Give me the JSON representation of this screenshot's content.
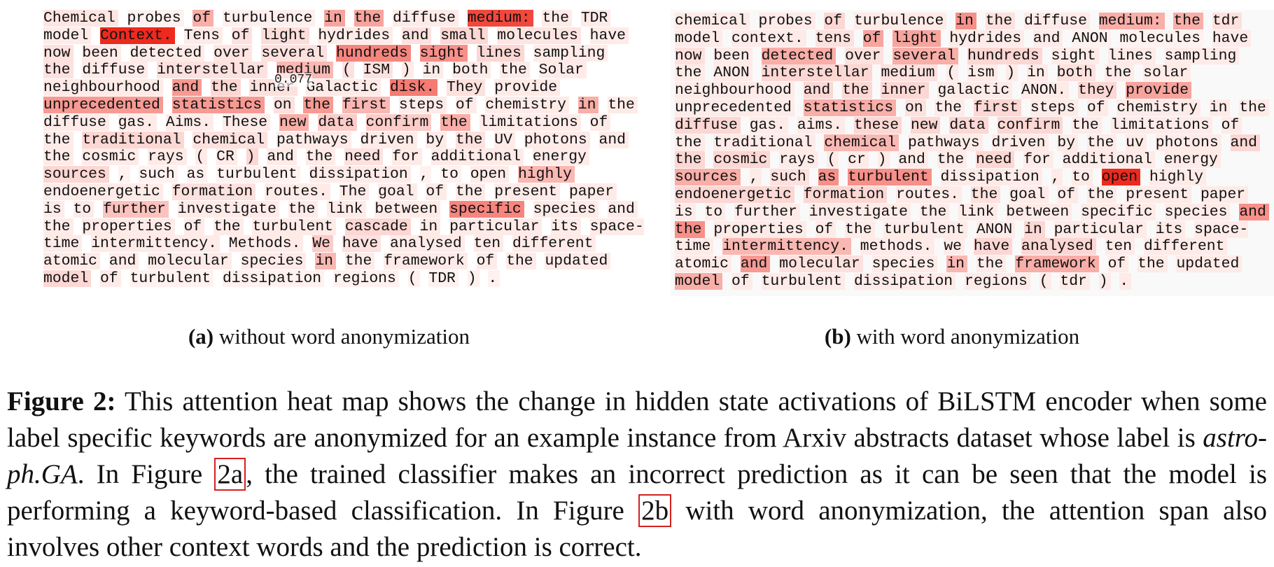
{
  "panel_a": {
    "tooltip_value": "0.077",
    "words": [
      {
        "t": "Chemical",
        "a": 0.08
      },
      {
        "t": "probes",
        "a": 0.02
      },
      {
        "t": "of",
        "a": 0.35
      },
      {
        "t": "turbulence",
        "a": 0.03
      },
      {
        "t": "in",
        "a": 0.4
      },
      {
        "t": "the",
        "a": 0.4
      },
      {
        "t": "diffuse",
        "a": 0.05
      },
      {
        "t": "medium:",
        "a": 0.85
      },
      {
        "t": "the",
        "a": 0.05
      },
      {
        "t": "TDR",
        "a": 0.05
      },
      {
        "t": "model",
        "a": 0.05
      },
      {
        "t": "Context.",
        "a": 1.0
      },
      {
        "t": "Tens",
        "a": 0.05
      },
      {
        "t": "of",
        "a": 0.1
      },
      {
        "t": "light",
        "a": 0.12
      },
      {
        "t": "hydrides",
        "a": 0.05
      },
      {
        "t": "and",
        "a": 0.1
      },
      {
        "t": "small",
        "a": 0.15
      },
      {
        "t": "molecules",
        "a": 0.08
      },
      {
        "t": "have",
        "a": 0.05
      },
      {
        "t": "now",
        "a": 0.1
      },
      {
        "t": "been",
        "a": 0.05
      },
      {
        "t": "detected",
        "a": 0.05
      },
      {
        "t": "over",
        "a": 0.08
      },
      {
        "t": "several",
        "a": 0.1
      },
      {
        "t": "hundreds",
        "a": 0.55
      },
      {
        "t": "sight",
        "a": 0.5
      },
      {
        "t": "lines",
        "a": 0.15
      },
      {
        "t": "sampling",
        "a": 0.05
      },
      {
        "t": "the",
        "a": 0.1
      },
      {
        "t": "diffuse",
        "a": 0.05
      },
      {
        "t": "interstellar",
        "a": 0.1
      },
      {
        "t": "medium",
        "a": 0.3
      },
      {
        "t": "(",
        "a": 0.1
      },
      {
        "t": "ISM",
        "a": 0.1
      },
      {
        "t": ")",
        "a": 0.05
      },
      {
        "t": "in",
        "a": 0.05
      },
      {
        "t": "both",
        "a": 0.05
      },
      {
        "t": "the",
        "a": 0.05
      },
      {
        "t": "Solar",
        "a": 0.05
      },
      {
        "t": "neighbourhood",
        "a": 0.05
      },
      {
        "t": "and",
        "a": 0.45
      },
      {
        "t": "the",
        "a": 0.15
      },
      {
        "t": "inner",
        "a": 0.1
      },
      {
        "t": "Galactic",
        "a": 0.05
      },
      {
        "t": "disk.",
        "a": 0.6
      },
      {
        "t": "They",
        "a": 0.1
      },
      {
        "t": "provide",
        "a": 0.05
      },
      {
        "t": "unprecedented",
        "a": 0.45
      },
      {
        "t": "statistics",
        "a": 0.45
      },
      {
        "t": "on",
        "a": 0.1
      },
      {
        "t": "the",
        "a": 0.45
      },
      {
        "t": "first",
        "a": 0.3
      },
      {
        "t": "steps",
        "a": 0.05
      },
      {
        "t": "of",
        "a": 0.05
      },
      {
        "t": "chemistry",
        "a": 0.05
      },
      {
        "t": "in",
        "a": 0.35
      },
      {
        "t": "the",
        "a": 0.05
      },
      {
        "t": "diffuse",
        "a": 0.05
      },
      {
        "t": "gas.",
        "a": 0.05
      },
      {
        "t": "Aims.",
        "a": 0.05
      },
      {
        "t": "These",
        "a": 0.05
      },
      {
        "t": "new",
        "a": 0.35
      },
      {
        "t": "data",
        "a": 0.2
      },
      {
        "t": "confirm",
        "a": 0.2
      },
      {
        "t": "the",
        "a": 0.35
      },
      {
        "t": "limitations",
        "a": 0.05
      },
      {
        "t": "of",
        "a": 0.05
      },
      {
        "t": "the",
        "a": 0.05
      },
      {
        "t": "traditional",
        "a": 0.15
      },
      {
        "t": "chemical",
        "a": 0.1
      },
      {
        "t": "pathways",
        "a": 0.05
      },
      {
        "t": "driven",
        "a": 0.05
      },
      {
        "t": "by",
        "a": 0.05
      },
      {
        "t": "the",
        "a": 0.1
      },
      {
        "t": "UV",
        "a": 0.05
      },
      {
        "t": "photons",
        "a": 0.05
      },
      {
        "t": "and",
        "a": 0.05
      },
      {
        "t": "the",
        "a": 0.05
      },
      {
        "t": "cosmic",
        "a": 0.05
      },
      {
        "t": "rays",
        "a": 0.05
      },
      {
        "t": "(",
        "a": 0.05
      },
      {
        "t": "CR",
        "a": 0.05
      },
      {
        "t": ")",
        "a": 0.15
      },
      {
        "t": "and",
        "a": 0.05
      },
      {
        "t": "the",
        "a": 0.05
      },
      {
        "t": "need",
        "a": 0.1
      },
      {
        "t": "for",
        "a": 0.05
      },
      {
        "t": "additional",
        "a": 0.05
      },
      {
        "t": "energy",
        "a": 0.05
      },
      {
        "t": "sources",
        "a": 0.15
      },
      {
        "t": ",",
        "a": 0.02
      },
      {
        "t": "such",
        "a": 0.02
      },
      {
        "t": "as",
        "a": 0.02
      },
      {
        "t": "turbulent",
        "a": 0.02
      },
      {
        "t": "dissipation",
        "a": 0.05
      },
      {
        "t": ",",
        "a": 0.02
      },
      {
        "t": "to",
        "a": 0.02
      },
      {
        "t": "open",
        "a": 0.05
      },
      {
        "t": "highly",
        "a": 0.3
      },
      {
        "t": "endoenergetic",
        "a": 0.05
      },
      {
        "t": "formation",
        "a": 0.1
      },
      {
        "t": "routes.",
        "a": 0.05
      },
      {
        "t": "The",
        "a": 0.05
      },
      {
        "t": "goal",
        "a": 0.05
      },
      {
        "t": "of",
        "a": 0.05
      },
      {
        "t": "the",
        "a": 0.05
      },
      {
        "t": "present",
        "a": 0.05
      },
      {
        "t": "paper",
        "a": 0.05
      },
      {
        "t": "is",
        "a": 0.05
      },
      {
        "t": "to",
        "a": 0.05
      },
      {
        "t": "further",
        "a": 0.25
      },
      {
        "t": "investigate",
        "a": 0.05
      },
      {
        "t": "the",
        "a": 0.05
      },
      {
        "t": "link",
        "a": 0.05
      },
      {
        "t": "between",
        "a": 0.05
      },
      {
        "t": "specific",
        "a": 0.55
      },
      {
        "t": "species",
        "a": 0.05
      },
      {
        "t": "and",
        "a": 0.05
      },
      {
        "t": "the",
        "a": 0.05
      },
      {
        "t": "properties",
        "a": 0.05
      },
      {
        "t": "of",
        "a": 0.05
      },
      {
        "t": "the",
        "a": 0.05
      },
      {
        "t": "turbulent",
        "a": 0.05
      },
      {
        "t": "cascade",
        "a": 0.15
      },
      {
        "t": "in",
        "a": 0.05
      },
      {
        "t": "particular",
        "a": 0.05
      },
      {
        "t": "its",
        "a": 0.05
      },
      {
        "t": "space-time",
        "a": 0.05
      },
      {
        "t": "intermittency.",
        "a": 0.05
      },
      {
        "t": "Methods.",
        "a": 0.05
      },
      {
        "t": "We",
        "a": 0.2
      },
      {
        "t": "have",
        "a": 0.1
      },
      {
        "t": "analysed",
        "a": 0.05
      },
      {
        "t": "ten",
        "a": 0.05
      },
      {
        "t": "different",
        "a": 0.05
      },
      {
        "t": "atomic",
        "a": 0.05
      },
      {
        "t": "and",
        "a": 0.05
      },
      {
        "t": "molecular",
        "a": 0.05
      },
      {
        "t": "species",
        "a": 0.05
      },
      {
        "t": "in",
        "a": 0.3
      },
      {
        "t": "the",
        "a": 0.05
      },
      {
        "t": "framework",
        "a": 0.05
      },
      {
        "t": "of",
        "a": 0.05
      },
      {
        "t": "the",
        "a": 0.05
      },
      {
        "t": "updated",
        "a": 0.05
      },
      {
        "t": "model",
        "a": 0.15
      },
      {
        "t": "of",
        "a": 0.05
      },
      {
        "t": "turbulent",
        "a": 0.02
      },
      {
        "t": "dissipation",
        "a": 0.02
      },
      {
        "t": "regions",
        "a": 0.02
      },
      {
        "t": "(",
        "a": 0.02
      },
      {
        "t": "TDR",
        "a": 0.02
      },
      {
        "t": ")",
        "a": 0.02
      },
      {
        "t": ".",
        "a": 0.02
      }
    ]
  },
  "panel_b": {
    "words": [
      {
        "t": "chemical",
        "a": 0.05
      },
      {
        "t": "probes",
        "a": 0.05
      },
      {
        "t": "of",
        "a": 0.15
      },
      {
        "t": "turbulence",
        "a": 0.05
      },
      {
        "t": "in",
        "a": 0.5
      },
      {
        "t": "the",
        "a": 0.1
      },
      {
        "t": "diffuse",
        "a": 0.05
      },
      {
        "t": "medium:",
        "a": 0.35
      },
      {
        "t": "the",
        "a": 0.35
      },
      {
        "t": "tdr",
        "a": 0.1
      },
      {
        "t": "model",
        "a": 0.05
      },
      {
        "t": "context.",
        "a": 0.05
      },
      {
        "t": "tens",
        "a": 0.1
      },
      {
        "t": "of",
        "a": 0.4
      },
      {
        "t": "light",
        "a": 0.4
      },
      {
        "t": "hydrides",
        "a": 0.05
      },
      {
        "t": "and",
        "a": 0.05
      },
      {
        "t": "ANON",
        "a": 0.02
      },
      {
        "t": "molecules",
        "a": 0.02
      },
      {
        "t": "have",
        "a": 0.05
      },
      {
        "t": "now",
        "a": 0.1
      },
      {
        "t": "been",
        "a": 0.05
      },
      {
        "t": "detected",
        "a": 0.35
      },
      {
        "t": "over",
        "a": 0.1
      },
      {
        "t": "several",
        "a": 0.35
      },
      {
        "t": "hundreds",
        "a": 0.15
      },
      {
        "t": "sight",
        "a": 0.05
      },
      {
        "t": "lines",
        "a": 0.05
      },
      {
        "t": "sampling",
        "a": 0.05
      },
      {
        "t": "the",
        "a": 0.05
      },
      {
        "t": "ANON",
        "a": 0.05
      },
      {
        "t": "interstellar",
        "a": 0.15
      },
      {
        "t": "medium",
        "a": 0.1
      },
      {
        "t": "(",
        "a": 0.05
      },
      {
        "t": "ism",
        "a": 0.05
      },
      {
        "t": ")",
        "a": 0.05
      },
      {
        "t": "in",
        "a": 0.05
      },
      {
        "t": "both",
        "a": 0.1
      },
      {
        "t": "the",
        "a": 0.05
      },
      {
        "t": "solar",
        "a": 0.05
      },
      {
        "t": "neighbourhood",
        "a": 0.05
      },
      {
        "t": "and",
        "a": 0.15
      },
      {
        "t": "the",
        "a": 0.15
      },
      {
        "t": "inner",
        "a": 0.15
      },
      {
        "t": "galactic",
        "a": 0.05
      },
      {
        "t": "ANON.",
        "a": 0.05
      },
      {
        "t": "they",
        "a": 0.15
      },
      {
        "t": "provide",
        "a": 0.4
      },
      {
        "t": "unprecedented",
        "a": 0.05
      },
      {
        "t": "statistics",
        "a": 0.35
      },
      {
        "t": "on",
        "a": 0.1
      },
      {
        "t": "the",
        "a": 0.05
      },
      {
        "t": "first",
        "a": 0.15
      },
      {
        "t": "steps",
        "a": 0.05
      },
      {
        "t": "of",
        "a": 0.05
      },
      {
        "t": "chemistry",
        "a": 0.05
      },
      {
        "t": "in",
        "a": 0.05
      },
      {
        "t": "the",
        "a": 0.05
      },
      {
        "t": "diffuse",
        "a": 0.15
      },
      {
        "t": "gas.",
        "a": 0.05
      },
      {
        "t": "aims.",
        "a": 0.05
      },
      {
        "t": "these",
        "a": 0.15
      },
      {
        "t": "new",
        "a": 0.15
      },
      {
        "t": "data",
        "a": 0.15
      },
      {
        "t": "confirm",
        "a": 0.15
      },
      {
        "t": "the",
        "a": 0.05
      },
      {
        "t": "limitations",
        "a": 0.05
      },
      {
        "t": "of",
        "a": 0.05
      },
      {
        "t": "the",
        "a": 0.05
      },
      {
        "t": "traditional",
        "a": 0.05
      },
      {
        "t": "chemical",
        "a": 0.3
      },
      {
        "t": "pathways",
        "a": 0.05
      },
      {
        "t": "driven",
        "a": 0.05
      },
      {
        "t": "by",
        "a": 0.05
      },
      {
        "t": "the",
        "a": 0.05
      },
      {
        "t": "uv",
        "a": 0.05
      },
      {
        "t": "photons",
        "a": 0.05
      },
      {
        "t": "and",
        "a": 0.15
      },
      {
        "t": "the",
        "a": 0.15
      },
      {
        "t": "cosmic",
        "a": 0.15
      },
      {
        "t": "rays",
        "a": 0.05
      },
      {
        "t": "(",
        "a": 0.05
      },
      {
        "t": "cr",
        "a": 0.05
      },
      {
        "t": ")",
        "a": 0.05
      },
      {
        "t": "and",
        "a": 0.05
      },
      {
        "t": "the",
        "a": 0.05
      },
      {
        "t": "need",
        "a": 0.15
      },
      {
        "t": "for",
        "a": 0.05
      },
      {
        "t": "additional",
        "a": 0.05
      },
      {
        "t": "energy",
        "a": 0.05
      },
      {
        "t": "sources",
        "a": 0.35
      },
      {
        "t": ",",
        "a": 0.05
      },
      {
        "t": "such",
        "a": 0.1
      },
      {
        "t": "as",
        "a": 0.5
      },
      {
        "t": "turbulent",
        "a": 0.5
      },
      {
        "t": "dissipation",
        "a": 0.05
      },
      {
        "t": ",",
        "a": 0.05
      },
      {
        "t": "to",
        "a": 0.05
      },
      {
        "t": "open",
        "a": 1.0
      },
      {
        "t": "highly",
        "a": 0.05
      },
      {
        "t": "endoenergetic",
        "a": 0.15
      },
      {
        "t": "formation",
        "a": 0.15
      },
      {
        "t": "routes.",
        "a": 0.05
      },
      {
        "t": "the",
        "a": 0.1
      },
      {
        "t": "goal",
        "a": 0.05
      },
      {
        "t": "of",
        "a": 0.05
      },
      {
        "t": "the",
        "a": 0.05
      },
      {
        "t": "present",
        "a": 0.05
      },
      {
        "t": "paper",
        "a": 0.05
      },
      {
        "t": "is",
        "a": 0.05
      },
      {
        "t": "to",
        "a": 0.05
      },
      {
        "t": "further",
        "a": 0.05
      },
      {
        "t": "investigate",
        "a": 0.05
      },
      {
        "t": "the",
        "a": 0.05
      },
      {
        "t": "link",
        "a": 0.05
      },
      {
        "t": "between",
        "a": 0.05
      },
      {
        "t": "specific",
        "a": 0.05
      },
      {
        "t": "species",
        "a": 0.05
      },
      {
        "t": "and",
        "a": 0.5
      },
      {
        "t": "the",
        "a": 0.5
      },
      {
        "t": "properties",
        "a": 0.05
      },
      {
        "t": "of",
        "a": 0.05
      },
      {
        "t": "the",
        "a": 0.05
      },
      {
        "t": "turbulent",
        "a": 0.05
      },
      {
        "t": "ANON",
        "a": 0.05
      },
      {
        "t": "in",
        "a": 0.15
      },
      {
        "t": "particular",
        "a": 0.05
      },
      {
        "t": "its",
        "a": 0.05
      },
      {
        "t": "space-time",
        "a": 0.05
      },
      {
        "t": "intermittency.",
        "a": 0.3
      },
      {
        "t": "methods.",
        "a": 0.05
      },
      {
        "t": "we",
        "a": 0.05
      },
      {
        "t": "have",
        "a": 0.15
      },
      {
        "t": "analysed",
        "a": 0.15
      },
      {
        "t": "ten",
        "a": 0.05
      },
      {
        "t": "different",
        "a": 0.05
      },
      {
        "t": "atomic",
        "a": 0.05
      },
      {
        "t": "and",
        "a": 0.45
      },
      {
        "t": "molecular",
        "a": 0.1
      },
      {
        "t": "species",
        "a": 0.05
      },
      {
        "t": "in",
        "a": 0.3
      },
      {
        "t": "the",
        "a": 0.05
      },
      {
        "t": "framework",
        "a": 0.35
      },
      {
        "t": "of",
        "a": 0.05
      },
      {
        "t": "the",
        "a": 0.05
      },
      {
        "t": "updated",
        "a": 0.05
      },
      {
        "t": "model",
        "a": 0.35
      },
      {
        "t": "of",
        "a": 0.05
      },
      {
        "t": "turbulent",
        "a": 0.05
      },
      {
        "t": "dissipation",
        "a": 0.05
      },
      {
        "t": "regions",
        "a": 0.05
      },
      {
        "t": "(",
        "a": 0.05
      },
      {
        "t": "tdr",
        "a": 0.05
      },
      {
        "t": ")",
        "a": 0.05
      },
      {
        "t": ".",
        "a": 0.05
      }
    ]
  },
  "sub_captions": {
    "a_label": "(a)",
    "a_text": "without word anonymization",
    "b_label": "(b)",
    "b_text": "with word anonymization"
  },
  "caption": {
    "label": "Figure 2:",
    "part1": "This attention heat map shows the change in hidden state activations of BiLSTM encoder when some label specific keywords are anonymized for an example instance from Arxiv abstracts dataset whose label is",
    "italic_label": "astro-ph.GA",
    "part2": ". In Figure",
    "ref_a": "2a",
    "part3": ", the trained classifier makes an incorrect prediction as it can be seen that the model is performing a keyword-based classification. In Figure",
    "ref_b": "2b",
    "part4": "with word anonymization, the attention span also involves other context words and the prediction is correct."
  },
  "colors": {
    "heat_max": "#ee2a1e",
    "heat_min": "#fff5f3",
    "ref_border": "#d42020"
  }
}
